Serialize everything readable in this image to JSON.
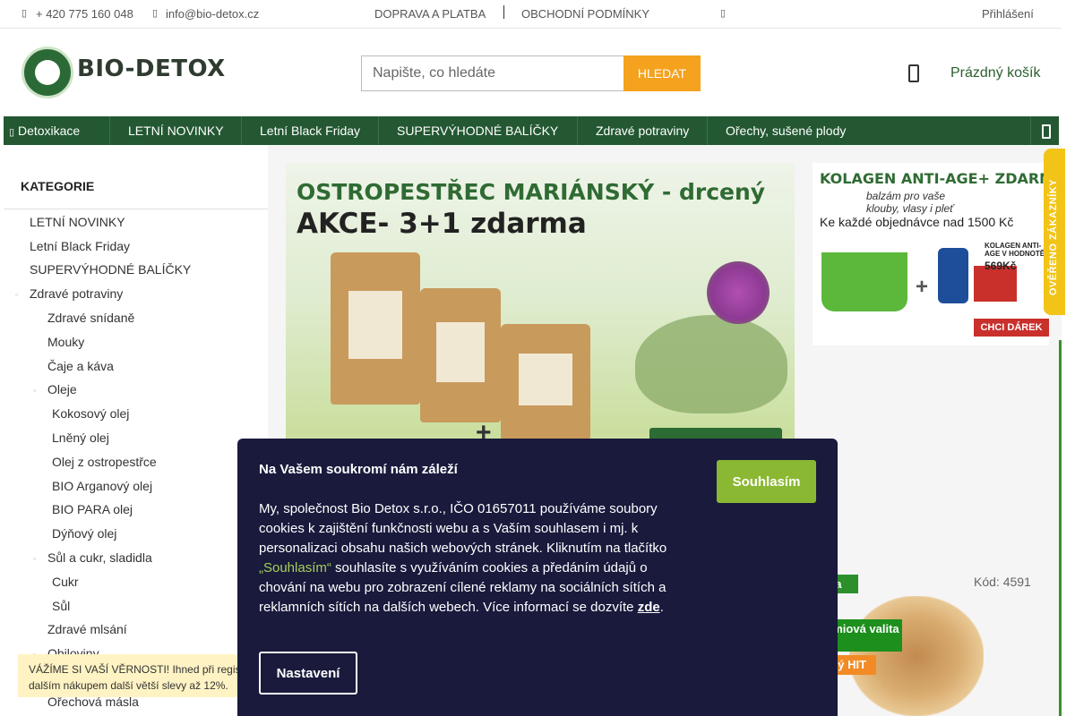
{
  "topbar": {
    "phone": "+ 420 775 160 048",
    "email": "info@bio-detox.cz",
    "links": [
      "DOPRAVA A PLATBA",
      "OBCHODNÍ PODMÍNKY"
    ],
    "login": "Přihlášení"
  },
  "header": {
    "logo_text": "BIO-DETOX",
    "search_placeholder": "Napište, co hledáte",
    "search_button": "HLEDAT",
    "cart_label": "Prázdný košík"
  },
  "nav": {
    "items": [
      "Detoxikace",
      "LETNÍ NOVINKY",
      "Letní Black Friday",
      "SUPERVÝHODNÉ BALÍČKY",
      "Zdravé potraviny",
      "Ořechy, sušené plody"
    ]
  },
  "sidebar": {
    "title": "KATEGORIE",
    "items": [
      {
        "label": "LETNÍ NOVINKY"
      },
      {
        "label": "Letní Black Friday"
      },
      {
        "label": "SUPERVÝHODNÉ BALÍČKY"
      },
      {
        "label": "Zdravé potraviny"
      },
      {
        "label": "Zdravé snídaně"
      },
      {
        "label": "Mouky"
      },
      {
        "label": "Čaje a káva"
      },
      {
        "label": "Oleje"
      },
      {
        "label": "Kokosový olej"
      },
      {
        "label": "Lněný olej"
      },
      {
        "label": "Olej z ostropestřce"
      },
      {
        "label": "BIO Arganový olej"
      },
      {
        "label": "BIO PARA olej"
      },
      {
        "label": "Dýňový olej"
      },
      {
        "label": "Sůl a cukr, sladidla"
      },
      {
        "label": "Cukr"
      },
      {
        "label": "Sůl"
      },
      {
        "label": "Zdravé mlsání"
      },
      {
        "label": "Obiloviny"
      },
      {
        "label": "Ořechová másla"
      }
    ]
  },
  "banner_main": {
    "title1": "OSTROPESTŘEC MARIÁNSKÝ - drcený",
    "title2": "AKCE- 3+1 zdarma",
    "plus": "+"
  },
  "banner_side": {
    "title": "KOLAGEN ANTI-AGE+ ZDARMA",
    "subtitle": "balzám pro vaše klouby, vlasy i pleť",
    "order_text": "Ke každé objednávce nad 1500 Kč",
    "kolagen_label": "KOLAGEN ANTI-AGE V HODNOTĚ",
    "price": "569Kč",
    "button": "CHCI DÁREK"
  },
  "verified": {
    "text": "OVĚŘENO ZÁKAZNÍKY"
  },
  "product": {
    "tag1": "ka",
    "code": "Kód: 4591",
    "tag2": "émiová valita",
    "tag3": "vý HIT"
  },
  "loyalty": {
    "line1": "VÁŽÍME SI VAŠÍ VĚRNOSTI! Ihned při regis",
    "line2": "dalším nákupem další větší slevy až 12%."
  },
  "cookie": {
    "title": "Na Vašem soukromí nám záleží",
    "accept": "Souhlasím",
    "text_part1": "My, společnost Bio Detox s.r.o., IČO 01657011 používáme soubory cookies k zajištění funkčnosti webu a s Vaším souhlasem i mj. k personalizaci obsahu našich webových stránek. Kliknutím na tlačítko ",
    "text_highlight": "„Souhlasím“",
    "text_part2": " souhlasíte s využíváním cookies a předáním údajů o chování na webu pro zobrazení cílené reklamy na sociálních sítích a reklamních sítích na dalších webech.  Více informací se dozvíte ",
    "text_link": "zde",
    "text_end": ".",
    "settings": "Nastavení"
  }
}
